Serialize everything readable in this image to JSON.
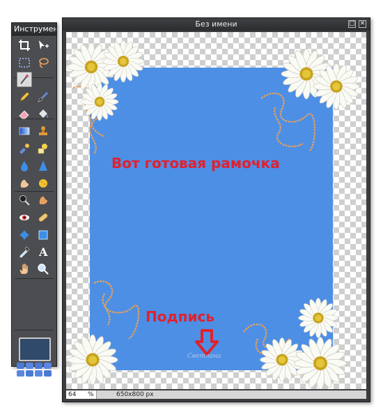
{
  "toolbox": {
    "title": "Инструмент",
    "tools": [
      {
        "icon": "crop-icon",
        "active": false
      },
      {
        "icon": "move-icon",
        "active": false
      },
      {
        "icon": "marquee-icon",
        "active": false
      },
      {
        "icon": "lasso-icon",
        "active": false
      },
      {
        "icon": "magic-wand-icon",
        "active": true
      },
      {
        "icon": "blank",
        "active": false
      },
      {
        "icon": "pencil-icon",
        "active": false
      },
      {
        "icon": "brush-icon",
        "active": false
      },
      {
        "icon": "eraser-icon",
        "active": false
      },
      {
        "icon": "paint-bucket-icon",
        "active": false
      },
      {
        "icon": "gradient-icon",
        "active": false
      },
      {
        "icon": "stamp-icon",
        "active": false
      },
      {
        "icon": "color-replace-icon",
        "active": false
      },
      {
        "icon": "shape-icon",
        "active": false
      },
      {
        "icon": "blur-icon",
        "active": false
      },
      {
        "icon": "sharpen-icon",
        "active": false
      },
      {
        "icon": "smudge-icon",
        "active": false
      },
      {
        "icon": "sponge-icon",
        "active": false
      },
      {
        "icon": "dodge-icon",
        "active": false
      },
      {
        "icon": "burn-icon",
        "active": false
      },
      {
        "icon": "red-eye-icon",
        "active": false
      },
      {
        "icon": "bandage-icon",
        "active": false
      },
      {
        "icon": "bloat-icon",
        "active": false
      },
      {
        "icon": "pinch-icon",
        "active": false
      },
      {
        "icon": "eyedropper-icon",
        "active": false
      },
      {
        "icon": "text-icon",
        "active": false
      },
      {
        "icon": "hand-icon",
        "active": false
      },
      {
        "icon": "zoom-icon",
        "active": false
      }
    ],
    "colors": {
      "primary": "#2f4a6b",
      "mini": "#4a7ad4"
    }
  },
  "document": {
    "title": "Без имени",
    "canvas": {
      "background": "#4d8fe5",
      "headline": "Вот готовая рамочка",
      "caption": "Подпись",
      "text_color": "#e0212e",
      "watermark": "Светлана",
      "decorations": "daisy-flower-icon"
    },
    "status": {
      "zoom_value": "64",
      "zoom_unit": "%",
      "dimensions": "650x800 px"
    }
  }
}
